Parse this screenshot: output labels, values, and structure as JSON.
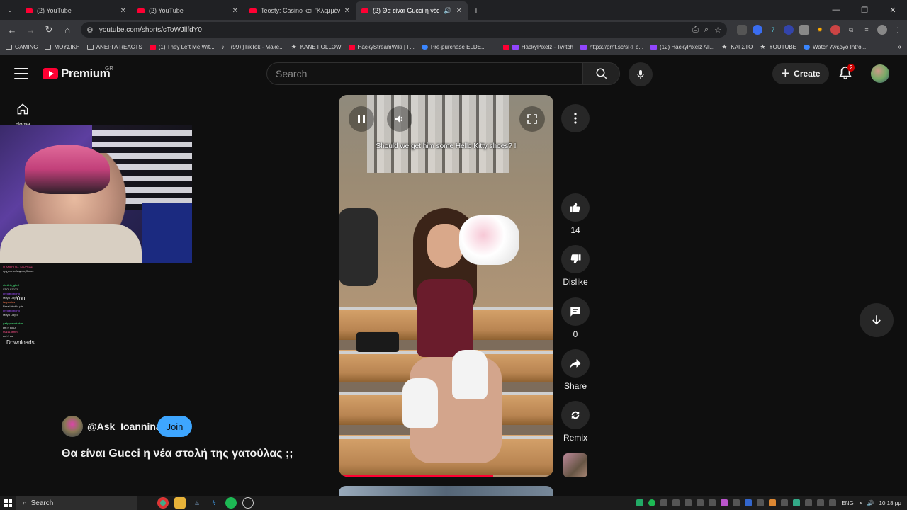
{
  "browser": {
    "tabs": [
      {
        "title": "(2) YouTube",
        "active": false
      },
      {
        "title": "(2) YouTube",
        "active": false
      },
      {
        "title": "Teosty: Casino και \"Κλεμμένα\" »",
        "active": false
      },
      {
        "title": "(2) Θα είναι Gucci η νέα στο",
        "active": true
      }
    ],
    "url": "youtube.com/shorts/cToWJllfdY0",
    "bookmarks": [
      {
        "label": "GAMING",
        "icon": "folder-icon"
      },
      {
        "label": "ΜΟΥΣΙΚΗ",
        "icon": "folder-icon"
      },
      {
        "label": "ΑΝΕΡΓΑ REACTS",
        "icon": "folder-icon"
      },
      {
        "label": "(1) They Left Me Wit...",
        "icon": "youtube-icon"
      },
      {
        "label": "(99+)TikTok - Make...",
        "icon": "tiktok-icon"
      },
      {
        "label": "KANE FOLLOW",
        "icon": "star-icon"
      },
      {
        "label": "HackyStreamWiki | F...",
        "icon": "wiki-icon"
      },
      {
        "label": "Pre-purchase ELDE...",
        "icon": "check-icon"
      },
      {
        "label": "HackyPixelz - Twitch",
        "icon": "twitch-icon"
      },
      {
        "label": "https://prnt.sc/sRFb...",
        "icon": "feather-icon"
      },
      {
        "label": "(12) HackyPixelz Ali...",
        "icon": "twitch-icon"
      },
      {
        "label": "ΚΑΙ ΣΤΟ",
        "icon": "star-icon"
      },
      {
        "label": "YOUTUBE",
        "icon": "star-icon"
      },
      {
        "label": "Watch Ανεργο Intro...",
        "icon": "globe-icon"
      }
    ]
  },
  "youtube": {
    "logo_text": "Premium",
    "region": "GR",
    "search_placeholder": "Search",
    "create_label": "Create",
    "notifications_count": "2",
    "nav": {
      "home_label": "Home",
      "you_label": "You",
      "downloads_label": "Downloads"
    }
  },
  "overlay": {
    "chat_lines": [
      {
        "text": "Ο ΑΝΕΡΓΟΣ ΤΣΟΡΕΑΣ",
        "tone": "c1"
      },
      {
        "text": "αρχιστε κολόφαρς δικιου",
        "tone": ""
      },
      {
        "text": "dimitris_gkrd",
        "tone": "c2"
      },
      {
        "text": "STOU ????",
        "tone": ""
      },
      {
        "text": "predatorbond",
        "tone": "c3"
      },
      {
        "text": "Μαγεί μαγεύ",
        "tone": ""
      },
      {
        "text": "tsopodius",
        "tone": "c4"
      },
      {
        "text": "Para lakobia pls",
        "tone": ""
      },
      {
        "text": "predatorbond",
        "tone": "c3"
      },
      {
        "text": "Μαγεί μαγεύ",
        "tone": ""
      },
      {
        "text": "galipperiorkakia",
        "tone": "c2"
      },
      {
        "text": "επί ή κούλ",
        "tone": ""
      },
      {
        "text": "mal113tmm",
        "tone": "c1"
      },
      {
        "text": "επί ή κα",
        "tone": ""
      }
    ]
  },
  "short": {
    "caption": "Should we get him some Hello Kitty shoes? !",
    "progress": 0.72,
    "likes": "14",
    "dislike_label": "Dislike",
    "comments": "0",
    "share_label": "Share",
    "remix_label": "Remix",
    "channel": "@Ask_Ioannina",
    "join_label": "Join",
    "title": "Θα είναι Gucci η νέα στολή της γατούλας ;;"
  },
  "taskbar": {
    "search_label": "Search",
    "language": "ENG",
    "time": "10:18 μμ"
  },
  "colors": {
    "youtube_red": "#ff0033",
    "join_blue": "#3ea6ff",
    "background": "#0f0f0f"
  }
}
